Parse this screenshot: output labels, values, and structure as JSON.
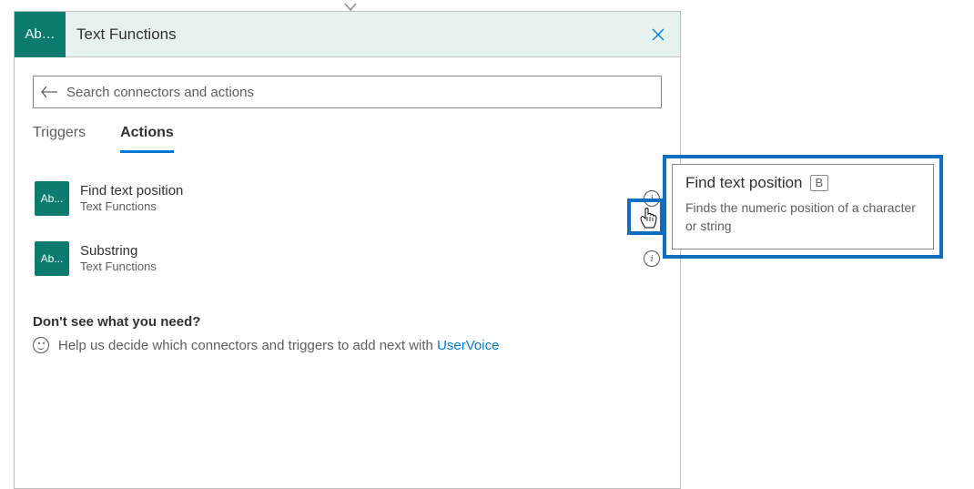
{
  "header": {
    "icon_text": "Ab…",
    "title": "Text Functions"
  },
  "search": {
    "placeholder": "Search connectors and actions"
  },
  "tabs": {
    "triggers": "Triggers",
    "actions": "Actions"
  },
  "actions": [
    {
      "icon": "Ab...",
      "title": "Find text position",
      "subtitle": "Text Functions"
    },
    {
      "icon": "Ab...",
      "title": "Substring",
      "subtitle": "Text Functions"
    }
  ],
  "help": {
    "title": "Don't see what you need?",
    "text": "Help us decide which connectors and triggers to add next with ",
    "link": "UserVoice"
  },
  "tooltip": {
    "title": "Find text position",
    "badge": "B",
    "description": "Finds the numeric position of a character or string"
  }
}
